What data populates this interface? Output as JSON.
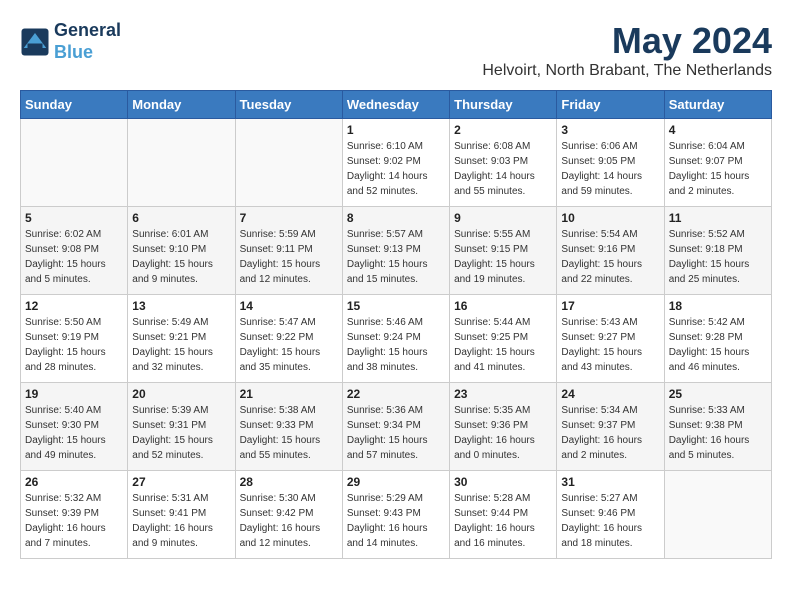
{
  "logo": {
    "line1": "General",
    "line2": "Blue"
  },
  "title": "May 2024",
  "subtitle": "Helvoirt, North Brabant, The Netherlands",
  "days_of_week": [
    "Sunday",
    "Monday",
    "Tuesday",
    "Wednesday",
    "Thursday",
    "Friday",
    "Saturday"
  ],
  "weeks": [
    [
      {
        "day": "",
        "info": ""
      },
      {
        "day": "",
        "info": ""
      },
      {
        "day": "",
        "info": ""
      },
      {
        "day": "1",
        "info": "Sunrise: 6:10 AM\nSunset: 9:02 PM\nDaylight: 14 hours\nand 52 minutes."
      },
      {
        "day": "2",
        "info": "Sunrise: 6:08 AM\nSunset: 9:03 PM\nDaylight: 14 hours\nand 55 minutes."
      },
      {
        "day": "3",
        "info": "Sunrise: 6:06 AM\nSunset: 9:05 PM\nDaylight: 14 hours\nand 59 minutes."
      },
      {
        "day": "4",
        "info": "Sunrise: 6:04 AM\nSunset: 9:07 PM\nDaylight: 15 hours\nand 2 minutes."
      }
    ],
    [
      {
        "day": "5",
        "info": "Sunrise: 6:02 AM\nSunset: 9:08 PM\nDaylight: 15 hours\nand 5 minutes."
      },
      {
        "day": "6",
        "info": "Sunrise: 6:01 AM\nSunset: 9:10 PM\nDaylight: 15 hours\nand 9 minutes."
      },
      {
        "day": "7",
        "info": "Sunrise: 5:59 AM\nSunset: 9:11 PM\nDaylight: 15 hours\nand 12 minutes."
      },
      {
        "day": "8",
        "info": "Sunrise: 5:57 AM\nSunset: 9:13 PM\nDaylight: 15 hours\nand 15 minutes."
      },
      {
        "day": "9",
        "info": "Sunrise: 5:55 AM\nSunset: 9:15 PM\nDaylight: 15 hours\nand 19 minutes."
      },
      {
        "day": "10",
        "info": "Sunrise: 5:54 AM\nSunset: 9:16 PM\nDaylight: 15 hours\nand 22 minutes."
      },
      {
        "day": "11",
        "info": "Sunrise: 5:52 AM\nSunset: 9:18 PM\nDaylight: 15 hours\nand 25 minutes."
      }
    ],
    [
      {
        "day": "12",
        "info": "Sunrise: 5:50 AM\nSunset: 9:19 PM\nDaylight: 15 hours\nand 28 minutes."
      },
      {
        "day": "13",
        "info": "Sunrise: 5:49 AM\nSunset: 9:21 PM\nDaylight: 15 hours\nand 32 minutes."
      },
      {
        "day": "14",
        "info": "Sunrise: 5:47 AM\nSunset: 9:22 PM\nDaylight: 15 hours\nand 35 minutes."
      },
      {
        "day": "15",
        "info": "Sunrise: 5:46 AM\nSunset: 9:24 PM\nDaylight: 15 hours\nand 38 minutes."
      },
      {
        "day": "16",
        "info": "Sunrise: 5:44 AM\nSunset: 9:25 PM\nDaylight: 15 hours\nand 41 minutes."
      },
      {
        "day": "17",
        "info": "Sunrise: 5:43 AM\nSunset: 9:27 PM\nDaylight: 15 hours\nand 43 minutes."
      },
      {
        "day": "18",
        "info": "Sunrise: 5:42 AM\nSunset: 9:28 PM\nDaylight: 15 hours\nand 46 minutes."
      }
    ],
    [
      {
        "day": "19",
        "info": "Sunrise: 5:40 AM\nSunset: 9:30 PM\nDaylight: 15 hours\nand 49 minutes."
      },
      {
        "day": "20",
        "info": "Sunrise: 5:39 AM\nSunset: 9:31 PM\nDaylight: 15 hours\nand 52 minutes."
      },
      {
        "day": "21",
        "info": "Sunrise: 5:38 AM\nSunset: 9:33 PM\nDaylight: 15 hours\nand 55 minutes."
      },
      {
        "day": "22",
        "info": "Sunrise: 5:36 AM\nSunset: 9:34 PM\nDaylight: 15 hours\nand 57 minutes."
      },
      {
        "day": "23",
        "info": "Sunrise: 5:35 AM\nSunset: 9:36 PM\nDaylight: 16 hours\nand 0 minutes."
      },
      {
        "day": "24",
        "info": "Sunrise: 5:34 AM\nSunset: 9:37 PM\nDaylight: 16 hours\nand 2 minutes."
      },
      {
        "day": "25",
        "info": "Sunrise: 5:33 AM\nSunset: 9:38 PM\nDaylight: 16 hours\nand 5 minutes."
      }
    ],
    [
      {
        "day": "26",
        "info": "Sunrise: 5:32 AM\nSunset: 9:39 PM\nDaylight: 16 hours\nand 7 minutes."
      },
      {
        "day": "27",
        "info": "Sunrise: 5:31 AM\nSunset: 9:41 PM\nDaylight: 16 hours\nand 9 minutes."
      },
      {
        "day": "28",
        "info": "Sunrise: 5:30 AM\nSunset: 9:42 PM\nDaylight: 16 hours\nand 12 minutes."
      },
      {
        "day": "29",
        "info": "Sunrise: 5:29 AM\nSunset: 9:43 PM\nDaylight: 16 hours\nand 14 minutes."
      },
      {
        "day": "30",
        "info": "Sunrise: 5:28 AM\nSunset: 9:44 PM\nDaylight: 16 hours\nand 16 minutes."
      },
      {
        "day": "31",
        "info": "Sunrise: 5:27 AM\nSunset: 9:46 PM\nDaylight: 16 hours\nand 18 minutes."
      },
      {
        "day": "",
        "info": ""
      }
    ]
  ]
}
